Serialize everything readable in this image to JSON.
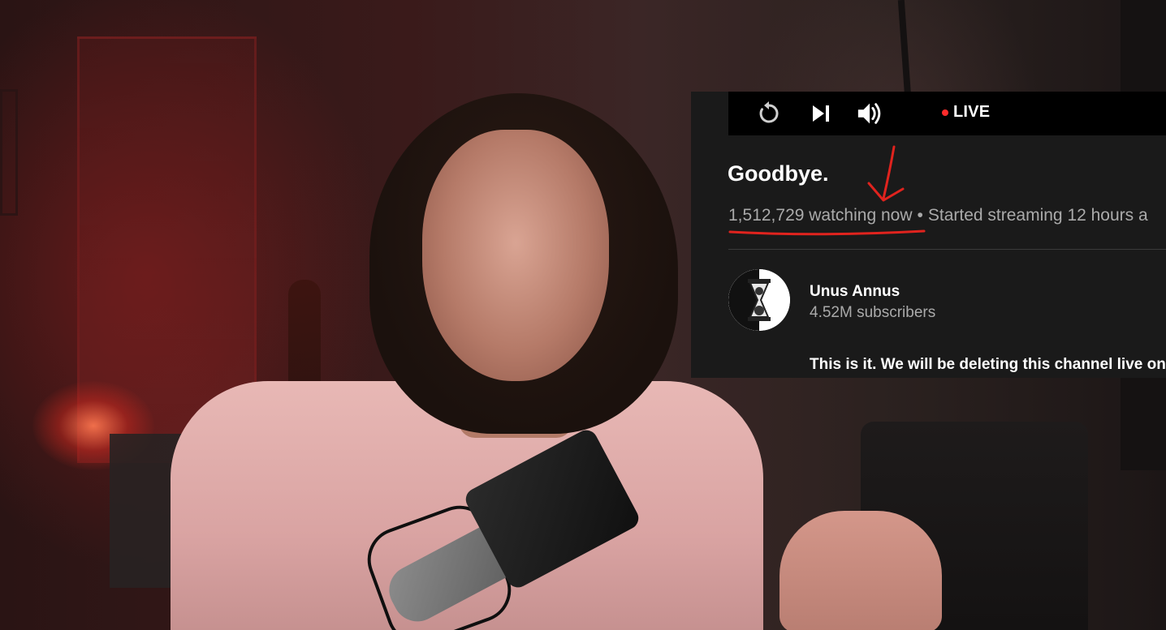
{
  "player": {
    "controls": {
      "replay_icon": "replay-icon",
      "next_icon": "skip-next-icon",
      "volume_icon": "volume-icon",
      "live_label": "LIVE"
    },
    "live_color": "#ff2b2b"
  },
  "video": {
    "title": "Goodbye.",
    "viewers": "1,512,729 watching now",
    "separator": "•",
    "started": "Started streaming 12 hours a"
  },
  "channel": {
    "avatar_icon": "hourglass-skull-icon",
    "name": "Unus Annus",
    "subscribers": "4.52M subscribers",
    "description": "This is it. We will be deleting this channel live on"
  },
  "annotation_color": "#e0231e"
}
